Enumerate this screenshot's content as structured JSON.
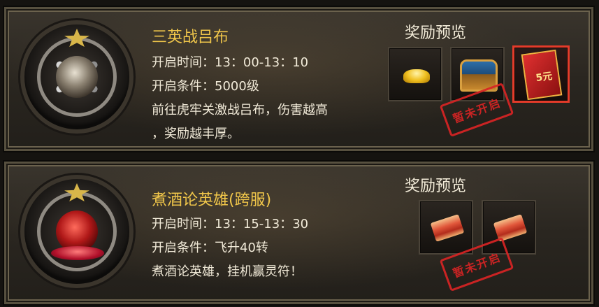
{
  "events": [
    {
      "title": "三英战吕布",
      "time_line": "开启时间：13：00-13：10",
      "condition_line": "开启条件：5000级",
      "desc_line1": "前往虎牢关激战吕布，伤害越高",
      "desc_line2": "，奖励越丰厚。",
      "reward_title": "奖励预览",
      "rewards": [
        {
          "icon": "gold-ingot-icon"
        },
        {
          "icon": "treasure-chest-icon"
        },
        {
          "icon": "red-envelope-icon",
          "label": "5元"
        }
      ],
      "stamp": "暂未开启"
    },
    {
      "title": "煮酒论英雄(跨服)",
      "time_line": "开启时间：13：15-13：30",
      "condition_line": "开启条件：飞升40转",
      "desc_line1": "煮酒论英雄，挂机赢灵符！",
      "reward_title": "奖励预览",
      "rewards": [
        {
          "icon": "talisman-scroll-icon"
        },
        {
          "icon": "talisman-scroll-icon"
        }
      ],
      "stamp": "暂未开启"
    }
  ]
}
